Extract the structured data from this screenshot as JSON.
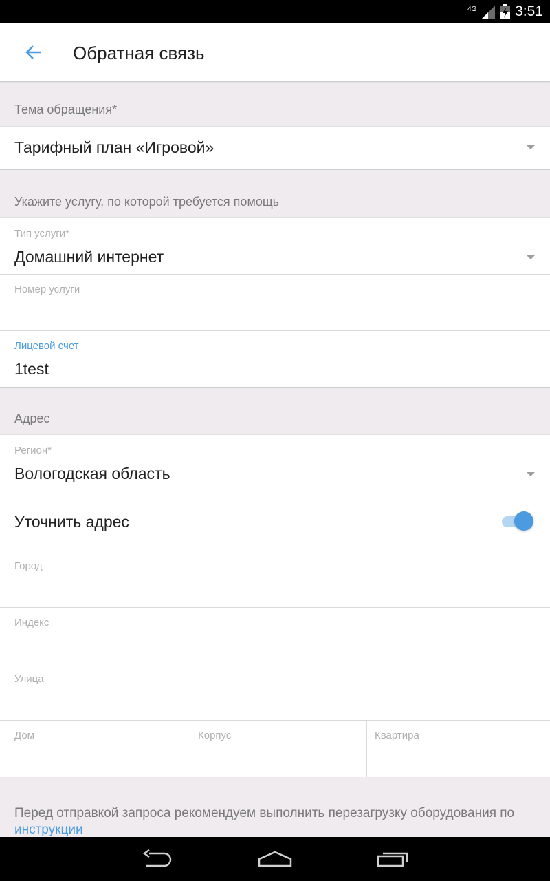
{
  "status_bar": {
    "time": "3:51",
    "network": "4G"
  },
  "toolbar": {
    "title": "Обратная связь"
  },
  "topic": {
    "section_label": "Тема обращения*",
    "value": "Тарифный план «Игровой»"
  },
  "service": {
    "section_label": "Укажите услугу, по которой требуется помощь",
    "type_label": "Тип услуги*",
    "type_value": "Домашний интернет",
    "number_label": "Номер услуги",
    "number_value": "",
    "account_label": "Лицевой счет",
    "account_value": "1test"
  },
  "address": {
    "section_label": "Адрес",
    "region_label": "Регион*",
    "region_value": "Вологодская область",
    "refine_label": "Уточнить адрес",
    "refine_enabled": true,
    "city_label": "Город",
    "index_label": "Индекс",
    "street_label": "Улица",
    "house_label": "Дом",
    "building_label": "Корпус",
    "apartment_label": "Квартира"
  },
  "notice": {
    "text": "Перед отправкой запроса рекомендуем выполнить перезагрузку оборудования по",
    "link": "инструкции"
  },
  "colors": {
    "accent": "#4a9be0",
    "background": "#efebee",
    "label": "#b0b0b0",
    "section_label": "#7a7a7a"
  },
  "icons": [
    "back-arrow-icon",
    "dropdown-arrow-icon",
    "signal-icon",
    "battery-icon",
    "nav-back-icon",
    "nav-home-icon",
    "nav-recents-icon"
  ]
}
